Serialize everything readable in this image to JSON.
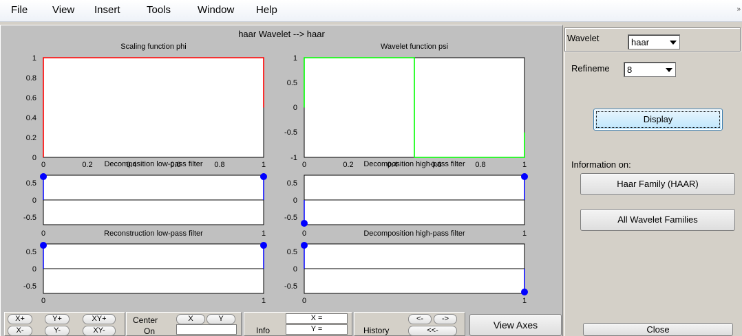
{
  "menu": [
    "File",
    "View",
    "Insert",
    "Tools",
    "Window",
    "Help"
  ],
  "menu_right_mark": "»",
  "figure_title": "haar Wavelet --> haar",
  "plots": {
    "phi_title": "Scaling function phi",
    "psi_title": "Wavelet function psi",
    "dec_lo_title": "Decomposition low-pass filter",
    "dec_hi_title": "Decomposition high-pass filter",
    "rec_lo_title": "Reconstruction low-pass filter",
    "rec_hi_title": "Decomposition high-pass filter",
    "phi_yticks": [
      "1",
      "0.8",
      "0.6",
      "0.4",
      "0.2",
      "0"
    ],
    "psi_yticks": [
      "1",
      "0.5",
      "0",
      "-0.5",
      "-1"
    ],
    "filter_yticks": [
      "0.5",
      "0",
      "-0.5"
    ],
    "x_top_ticks": [
      "0",
      "0.2",
      "0.4",
      "0.6",
      "0.8",
      "1"
    ],
    "x_filter_ticks": [
      "0",
      "1"
    ],
    "phi_color": "#ff0000",
    "psi_color": "#00ff00",
    "stem_color": "#0000ff"
  },
  "chart_data": [
    {
      "type": "line",
      "title": "Scaling function phi",
      "x": [
        0,
        0,
        1,
        1
      ],
      "y": [
        0,
        1,
        1,
        0.5
      ],
      "xlim": [
        0,
        1
      ],
      "ylim": [
        0,
        1
      ]
    },
    {
      "type": "line",
      "title": "Wavelet function psi",
      "x": [
        0,
        0,
        0.5,
        0.5,
        1,
        1
      ],
      "y": [
        0,
        1,
        1,
        -1,
        -1,
        -0.5
      ],
      "xlim": [
        0,
        1
      ],
      "ylim": [
        -1,
        1
      ]
    },
    {
      "type": "scatter",
      "title": "Decomposition low-pass filter",
      "x": [
        0,
        1
      ],
      "y": [
        0.7071,
        0.7071
      ],
      "ylim": [
        -0.75,
        0.75
      ]
    },
    {
      "type": "scatter",
      "title": "Decomposition high-pass filter",
      "x": [
        0,
        1
      ],
      "y": [
        -0.7071,
        0.7071
      ],
      "ylim": [
        -0.75,
        0.75
      ]
    },
    {
      "type": "scatter",
      "title": "Reconstruction low-pass filter",
      "x": [
        0,
        1
      ],
      "y": [
        0.7071,
        0.7071
      ],
      "ylim": [
        -0.75,
        0.75
      ]
    },
    {
      "type": "scatter",
      "title": "Decomposition high-pass filter",
      "x": [
        0,
        1
      ],
      "y": [
        0.7071,
        -0.7071
      ],
      "ylim": [
        -0.75,
        0.75
      ]
    }
  ],
  "right_panel": {
    "wavelet_label": "Wavelet",
    "wavelet_value": "haar",
    "refinement_label": "Refineme",
    "refinement_value": "8",
    "display_label": "Display",
    "info_label": "Information on:",
    "haar_family_label": "Haar Family (HAAR)",
    "all_families_label": "All Wavelet Families",
    "close_label": "Close"
  },
  "toolbar": {
    "xplus": "X+",
    "yplus": "Y+",
    "xyplus": "XY+",
    "xminus": "X-",
    "yminus": "Y-",
    "xyminus": "XY-",
    "center_label": "Center",
    "on_label": "On",
    "center_x": "X",
    "center_y": "Y",
    "info_label": "Info",
    "x_eq": "X =",
    "y_eq": "Y =",
    "history_label": "History",
    "hist_back": "<-",
    "hist_fwd": "->",
    "hist_first": "<<-",
    "view_axes": "View Axes"
  }
}
